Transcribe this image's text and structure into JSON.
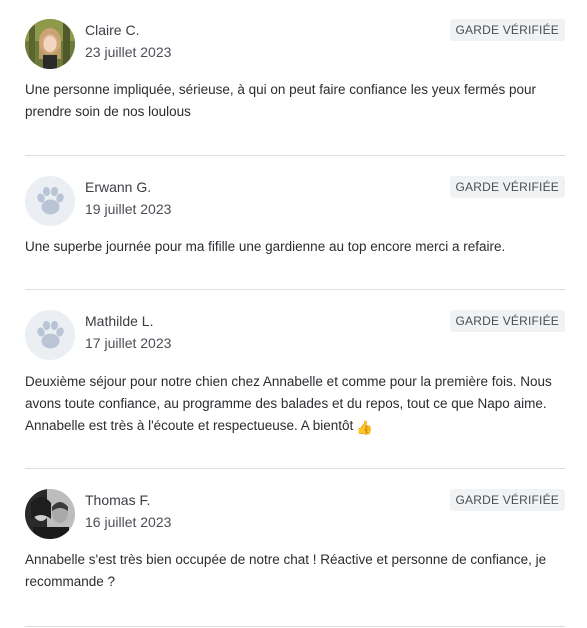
{
  "badge_label": "GARDE VÉRIFIÉE",
  "reviews": [
    {
      "author": "Claire C.",
      "date": "23 juillet 2023",
      "text": "Une personne impliquée, sérieuse, à qui on peut faire confiance les yeux fermés pour prendre soin de nos loulous",
      "avatar": "photo"
    },
    {
      "author": "Erwann G.",
      "date": "19 juillet 2023",
      "text": "Une superbe journée pour ma fifille une gardienne au top encore merci a refaire.",
      "avatar": "paw-icon"
    },
    {
      "author": "Mathilde L.",
      "date": "17 juillet 2023",
      "text": "Deuxième séjour pour notre chien chez Annabelle et comme pour la première fois. Nous avons toute confiance, au programme des balades et du repos, tout ce que Napo aime. Annabelle est très à l'écoute et respectueuse. A bientôt",
      "emoji": "👍",
      "avatar": "paw-icon"
    },
    {
      "author": "Thomas F.",
      "date": "16 juillet 2023",
      "text": "Annabelle s'est très bien occupée de notre chat ! Réactive et personne de confiance, je recommande ?",
      "avatar": "photo"
    }
  ]
}
